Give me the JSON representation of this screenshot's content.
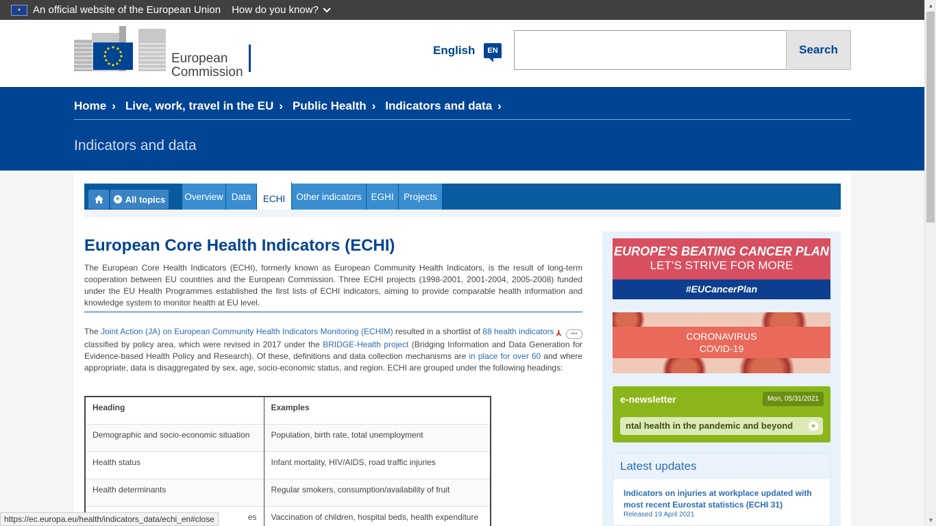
{
  "eu_bar": {
    "official_text": "An official website of the European Union",
    "how_text": "How do you know?"
  },
  "header": {
    "logo_line1": "European",
    "logo_line2": "Commission",
    "language": "English",
    "language_code": "EN",
    "search_label": "Search",
    "search_placeholder": ""
  },
  "breadcrumbs": [
    "Home",
    "Live, work, travel in the EU",
    "Public Health",
    "Indicators and data"
  ],
  "page_title": "Indicators and data",
  "nav": {
    "all_topics": "All topics",
    "tabs": [
      "Overview",
      "Data",
      "ECHI",
      "Other indicators",
      "EGHI",
      "Projects"
    ],
    "active_tab": "ECHI"
  },
  "content": {
    "heading": "European Core Health Indicators (ECHI)",
    "intro": "The European Core Health Indicators (ECHI), formerly known as European Community Health Indicators, is the result of long-term cooperation between EU countries and the European Commission. Three ECHI projects (1998-2001, 2001-2004, 2005-2008) funded under the EU Health Programmes established the first lists of ECHI indicators, aiming to provide comparable health information and knowledge system to monitor health at EU level.",
    "p2_a": "The ",
    "p2_link1": "Joint Action (JA) on European Community Health Indicators Monitoring (ECHIM)",
    "p2_b": " resulted in a shortlist of ",
    "p2_link2": "88 health indicators",
    "p2_c": " classified by policy area, which were revised in 2017 under the ",
    "p2_link3": "BRIDGE-Health project",
    "p2_d": " (Bridging Information and Data Generation for Evidence-based Health Policy and Research). Of these, definitions and data collection mechanisms are ",
    "p2_link4": "in place for over 60",
    "p2_e": " and where appropriate, data is disaggregated by sex, age, socio-economic status, and region. ECHI are grouped under the following headings:",
    "table": {
      "headers": [
        "Heading",
        "Examples"
      ],
      "rows": [
        [
          "Demographic and socio-economic situation",
          "Population, birth rate, total unemployment"
        ],
        [
          "Health status",
          "Infant mortality, HIV/AIDS, road traffic injuries"
        ],
        [
          "Health determinants",
          "Regular smokers, consumption/availability of fruit"
        ],
        [
          "es",
          "Vaccination of children, hospital beds, health expenditure"
        ]
      ]
    }
  },
  "sidebar": {
    "cancer_title": "EUROPE’S BEATING CANCER PLAN",
    "cancer_sub": "LET’S STRIVE FOR MORE",
    "cancer_tag": "#EUCancerPlan",
    "covid_line1": "CORONAVIRUS",
    "covid_line2": "COVID-19",
    "enews_title": "e-newsletter",
    "enews_date": "Mon, 05/31/2021",
    "enews_item": "ntal health in the pandemic and beyond",
    "latest_title": "Latest updates",
    "latest_item": "Indicators on injuries at workplace updated with most recent Eurostat statistics (ECHI 31)",
    "latest_date": "Released 19 April 2021"
  },
  "status_url": "https://ec.europa.eu/health/indicators_data/echi_en#close",
  "colors": {
    "brand_blue": "#004494",
    "tab_blue": "#3a8ed0",
    "newsletter_green": "#8ab61b",
    "cancer_red": "#d84f5f"
  }
}
